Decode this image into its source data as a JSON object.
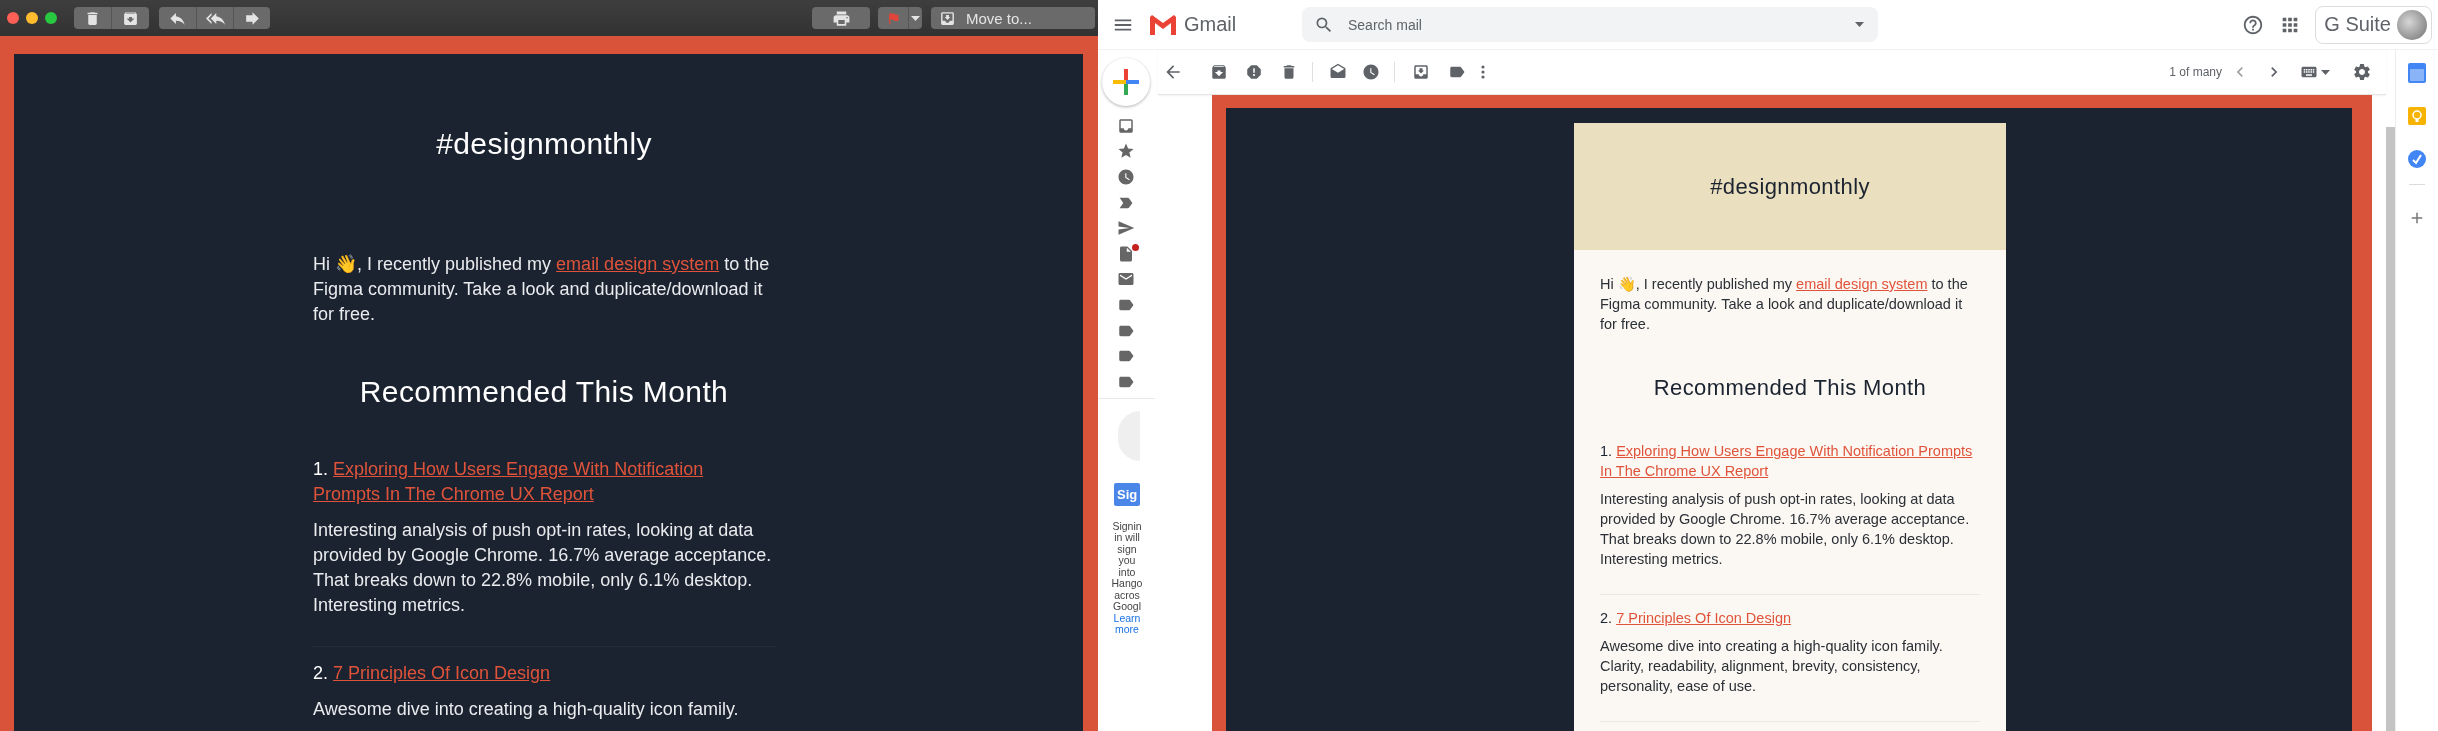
{
  "mail_app": {
    "toolbar": {
      "move_to": "Move to..."
    },
    "email": {
      "title": "#designmonthly",
      "intro": {
        "before": "Hi 👋, I recently published my",
        "link": "email design system",
        "after": "to the Figma community. Take a look and duplicate/download it for free."
      },
      "section_title": "Recommended This Month",
      "items": [
        {
          "number": "1.",
          "title": "Exploring How Users Engage With Notification Prompts In The Chrome UX Report",
          "description": "Interesting analysis of push opt-in rates, looking at data provided by Google Chrome. 16.7% average acceptance. That breaks down to 22.8% mobile, only 6.1% desktop. Interesting metrics."
        },
        {
          "number": "2.",
          "title": "7 Principles Of Icon Design",
          "description": "Awesome dive into creating a high-quality icon family."
        }
      ]
    }
  },
  "gmail": {
    "app_name": "Gmail",
    "search": {
      "placeholder": "Search mail"
    },
    "account": {
      "label": "G Suite"
    },
    "pager": "1 of many",
    "hangouts": {
      "button": "Sig",
      "note_lines": [
        "Signin",
        "in will",
        "sign",
        "you",
        "into",
        "Hango",
        "acros",
        "Googl"
      ],
      "link_lines": [
        "Learn",
        "more"
      ]
    },
    "email": {
      "title": "#designmonthly",
      "intro": {
        "before": "Hi 👋, I recently published my",
        "link": "email design system",
        "after": "to the Figma community. Take a look and duplicate/download it for free."
      },
      "section_title": "Recommended This Month",
      "items": [
        {
          "number": "1.",
          "title": "Exploring How Users Engage With Notification Prompts In The Chrome UX Report",
          "description": "Interesting analysis of push opt-in rates, looking at data provided by Google Chrome. 16.7% average acceptance. That breaks down to 22.8% mobile, only 6.1% desktop. Interesting metrics."
        },
        {
          "number": "2.",
          "title": "7 Principles Of Icon Design",
          "description": "Awesome dive into creating a high-quality icon family. Clarity, readability, alignment, brevity, consistency, personality, ease of use."
        }
      ]
    }
  }
}
